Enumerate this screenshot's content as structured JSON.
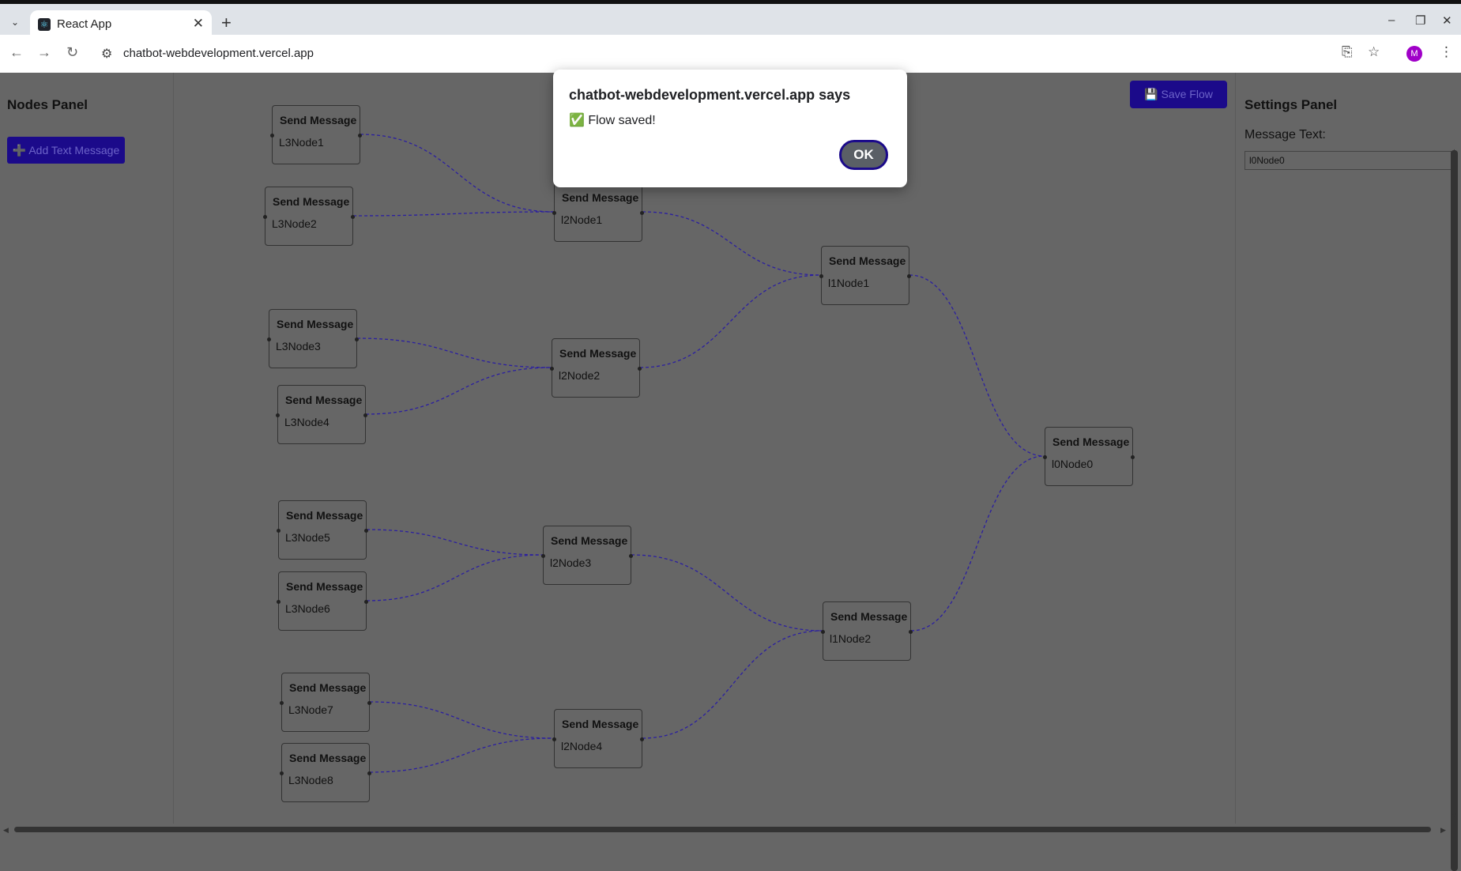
{
  "browser": {
    "tab_title": "React App",
    "tab_close": "✕",
    "new_tab": "+",
    "dropdown": "⌄",
    "url": "chatbot-webdevelopment.vercel.app",
    "back": "←",
    "forward": "→",
    "reload": "↻",
    "site_info": "⚙",
    "install": "⎘",
    "bookmark": "☆",
    "menu": "⋮",
    "profile_initial": "M",
    "minimize": "–",
    "restore": "❐",
    "close": "✕",
    "favicon": "⚛"
  },
  "nodes_panel": {
    "title": "Nodes Panel",
    "add_button": "➕ Add Text Message"
  },
  "toolbar": {
    "save_label": "💾 Save Flow"
  },
  "settings_panel": {
    "title": "Settings Panel",
    "message_label": "Message Text:",
    "message_value": "l0Node0"
  },
  "flow": {
    "nodes": [
      {
        "title": "Send Message",
        "text": "L3Node1"
      },
      {
        "title": "Send Message",
        "text": "L3Node2"
      },
      {
        "title": "Send Message",
        "text": "L3Node3"
      },
      {
        "title": "Send Message",
        "text": "L3Node4"
      },
      {
        "title": "Send Message",
        "text": "L3Node5"
      },
      {
        "title": "Send Message",
        "text": "L3Node6"
      },
      {
        "title": "Send Message",
        "text": "L3Node7"
      },
      {
        "title": "Send Message",
        "text": "L3Node8"
      },
      {
        "title": "Send Message",
        "text": "l2Node1"
      },
      {
        "title": "Send Message",
        "text": "l2Node2"
      },
      {
        "title": "Send Message",
        "text": "l2Node3"
      },
      {
        "title": "Send Message",
        "text": "l2Node4"
      },
      {
        "title": "Send Message",
        "text": "l1Node1"
      },
      {
        "title": "Send Message",
        "text": "l1Node2"
      },
      {
        "title": "Send Message",
        "text": "l0Node0"
      }
    ],
    "edge_color": "#2b1fa0"
  },
  "dialog": {
    "title": "chatbot-webdevelopment.vercel.app says",
    "message": "✅ Flow saved!",
    "ok": "OK"
  }
}
